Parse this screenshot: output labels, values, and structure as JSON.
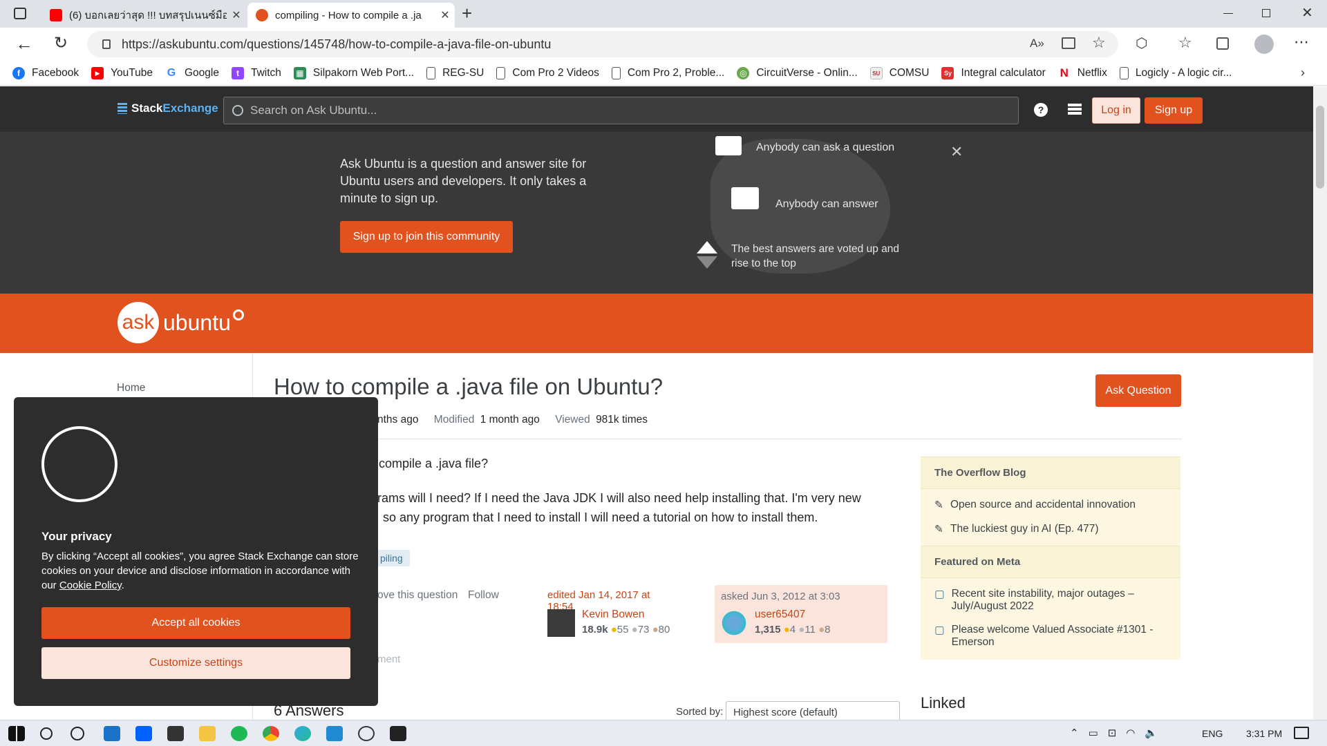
{
  "browser": {
    "tabs": [
      {
        "title": "(6) บอกเลยว่าสุด !!! บทสรุปเนนซ์มือถ"
      },
      {
        "title": "compiling - How to compile a .ja"
      }
    ],
    "new_tab": "+",
    "url": "https://askubuntu.com/questions/145748/how-to-compile-a-java-file-on-ubuntu",
    "bookmarks": [
      {
        "label": "Facebook",
        "color": "#1877f2",
        "glyph": "f"
      },
      {
        "label": "YouTube",
        "color": "#ff0000",
        "glyph": "▶"
      },
      {
        "label": "Google",
        "color": "#4285f4",
        "glyph": "G"
      },
      {
        "label": "Twitch",
        "color": "#9146ff",
        "glyph": "t"
      },
      {
        "label": "Silpakorn Web Port...",
        "color": "#2e8b57",
        "glyph": "▦"
      },
      {
        "label": "REG-SU",
        "color": "#888888",
        "glyph": ""
      },
      {
        "label": "Com Pro 2 Videos",
        "color": "#888888",
        "glyph": ""
      },
      {
        "label": "Com Pro 2, Proble...",
        "color": "#888888",
        "glyph": ""
      },
      {
        "label": "CircuitVerse - Onlin...",
        "color": "#6aa84f",
        "glyph": "◎"
      },
      {
        "label": "COMSU",
        "color": "#cccccc",
        "glyph": "SU"
      },
      {
        "label": "Integral calculator",
        "color": "#e03030",
        "glyph": "Sy"
      },
      {
        "label": "Netflix",
        "color": "#e50914",
        "glyph": "N"
      },
      {
        "label": "Logicly - A logic cir...",
        "color": "#888888",
        "glyph": ""
      }
    ]
  },
  "site": {
    "brand_a": "Stack",
    "brand_b": "Exchange",
    "search_placeholder": "Search on Ask Ubuntu...",
    "login": "Log in",
    "signup": "Sign up",
    "hero": {
      "text": "Ask Ubuntu is a question and answer site for Ubuntu users and developers. It only takes a minute to sign up.",
      "cta": "Sign up to join this community",
      "f1": "Anybody can ask a question",
      "f2": "Anybody can answer",
      "f3": "The best answers are voted up and rise to the top",
      "close": "✕"
    },
    "logo_a": "ask",
    "logo_b": "ubuntu"
  },
  "nav": {
    "home": "Home"
  },
  "question": {
    "title": "How to compile a .java file on Ubuntu?",
    "ask_button": "Ask Question",
    "asked_tail": "nths ago",
    "modified_label": "Modified",
    "modified_value": "1 month ago",
    "viewed_label": "Viewed",
    "viewed_value": "981k times",
    "body1": "compile a .java file?",
    "body2a": "rams will I need? If I need the Java JDK I will also need help installing that. I'm very new",
    "body2b": "so any program that I need to install I will need a tutorial on how to install them.",
    "tag": "piling",
    "actions": "ove this question",
    "follow": "Follow",
    "edited": "edited Jan 14, 2017 at 18:54",
    "editor": {
      "name": "Kevin Bowen",
      "rep": "18.9k",
      "gold": "55",
      "silver": "73",
      "bronze": "80"
    },
    "asked": "asked Jun 3, 2012 at 3:03",
    "asker": {
      "name": "user65407",
      "rep": "1,315",
      "gold": "4",
      "silver": "11",
      "bronze": "8"
    },
    "comment": "ment",
    "answers": "6 Answers",
    "sorted_label": "Sorted by:",
    "sorted_value": "Highest score (default)"
  },
  "sidebar_right": {
    "blog_title": "The Overflow Blog",
    "blog_items": [
      "Open source and accidental innovation",
      "The luckiest guy in AI (Ep. 477)"
    ],
    "meta_title": "Featured on Meta",
    "meta_items": [
      "Recent site instability, major outages – July/August 2022",
      "Please welcome Valued Associate #1301 - Emerson"
    ],
    "linked": "Linked"
  },
  "cookie": {
    "title": "Your privacy",
    "text": "By clicking “Accept all cookies”, you agree Stack Exchange can store cookies on your device and disclose information in accordance with our ",
    "link": "Cookie Policy",
    "period": ".",
    "accept": "Accept all cookies",
    "customize": "Customize settings"
  },
  "taskbar": {
    "lang": "ENG",
    "time": "3:31 PM"
  }
}
